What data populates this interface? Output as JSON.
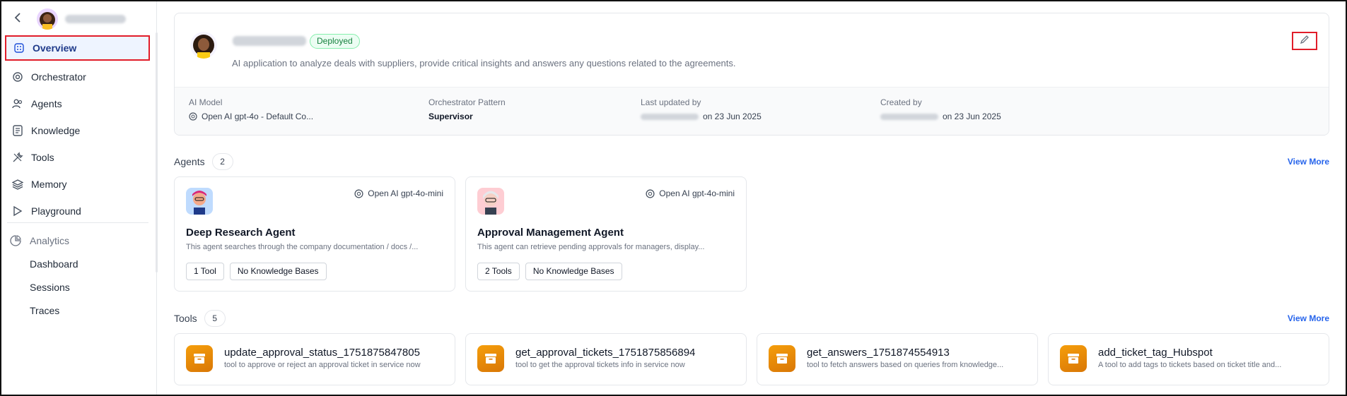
{
  "sidebar": {
    "items": [
      {
        "label": "Overview",
        "icon": "grid-icon"
      },
      {
        "label": "Orchestrator",
        "icon": "orchestrator-icon"
      },
      {
        "label": "Agents",
        "icon": "users-icon"
      },
      {
        "label": "Knowledge",
        "icon": "document-icon"
      },
      {
        "label": "Tools",
        "icon": "tools-icon"
      },
      {
        "label": "Memory",
        "icon": "layers-icon"
      },
      {
        "label": "Playground",
        "icon": "play-icon"
      }
    ],
    "analytics": {
      "label": "Analytics",
      "icon": "pie-chart-icon",
      "children": [
        "Dashboard",
        "Sessions",
        "Traces"
      ]
    }
  },
  "app": {
    "status": "Deployed",
    "description": "AI application to analyze deals with suppliers, provide critical insights and answers any questions related to the agreements.",
    "meta": {
      "model_label": "AI Model",
      "model_value": "Open AI gpt-4o - Default Co...",
      "pattern_label": "Orchestrator Pattern",
      "pattern_value": "Supervisor",
      "updated_label": "Last updated by",
      "updated_date": "on 23 Jun 2025",
      "created_label": "Created by",
      "created_date": "on 23 Jun 2025"
    }
  },
  "agents_section": {
    "title": "Agents",
    "count": "2",
    "view_more": "View More",
    "items": [
      {
        "model": "Open AI gpt-4o-mini",
        "title": "Deep Research Agent",
        "desc": "This agent searches through the company documentation / docs /...",
        "tools": "1 Tool",
        "kb": "No Knowledge Bases"
      },
      {
        "model": "Open AI gpt-4o-mini",
        "title": "Approval Management Agent",
        "desc": "This agent can retrieve pending approvals for managers, display...",
        "tools": "2 Tools",
        "kb": "No Knowledge Bases"
      }
    ]
  },
  "tools_section": {
    "title": "Tools",
    "count": "5",
    "view_more": "View More",
    "items": [
      {
        "name": "update_approval_status_1751875847805",
        "desc": "tool to approve or reject an approval ticket in service now"
      },
      {
        "name": "get_approval_tickets_1751875856894",
        "desc": "tool to get the approval tickets info in service now"
      },
      {
        "name": "get_answers_1751874554913",
        "desc": "tool to fetch answers based on queries from knowledge..."
      },
      {
        "name": "add_ticket_tag_Hubspot",
        "desc": "A tool to add tags to tickets based on ticket title and..."
      }
    ]
  },
  "colors": {
    "accent": "#1d4ed8",
    "highlight": "#e11d2a",
    "success": "#15803d",
    "tool_icon": "#f59e0b"
  }
}
